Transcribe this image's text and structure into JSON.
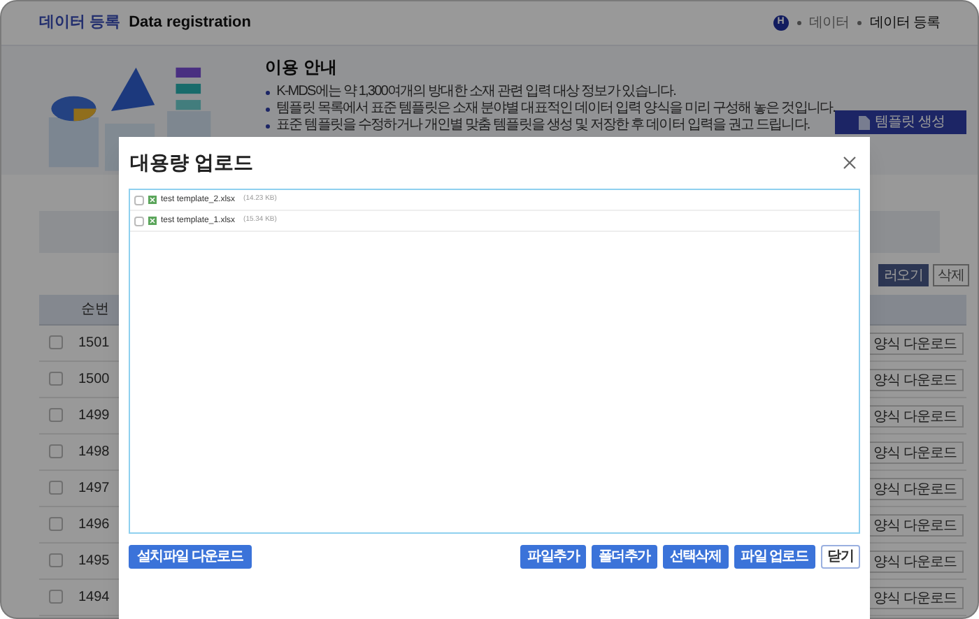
{
  "header": {
    "title_ko": "데이터 등록",
    "title_en": "Data registration",
    "home": "H",
    "breadcrumb": [
      "데이터",
      "데이터 등록"
    ]
  },
  "info": {
    "title": "이용 안내",
    "bullets": [
      "K-MDS에는 약 1,300여개의 방대한 소재 관련 입력 대상 정보가 있습니다.",
      "템플릿 목록에서 표준 템플릿은 소재 분야별 대표적인 데이터 입력 양식을 미리 구성해 놓은 것입니다.",
      "표준 템플릿을 수정하거나 개인별 맞춤 템플릿을 생성 및 저장한 후 데이터 입력을 권고 드립니다."
    ],
    "button": "템플릿 생성"
  },
  "toolbar": [
    {
      "label": "러오기",
      "kind": "primary"
    },
    {
      "label": "삭제",
      "kind": "outline"
    }
  ],
  "table": {
    "column": "순번",
    "rows": [
      {
        "no": "1501",
        "checked": false,
        "action": "양식 다운로드"
      },
      {
        "no": "1500",
        "checked": false,
        "action": "양식 다운로드"
      },
      {
        "no": "1499",
        "checked": false,
        "action": "양식 다운로드"
      },
      {
        "no": "1498",
        "checked": false,
        "action": "양식 다운로드"
      },
      {
        "no": "1497",
        "checked": false,
        "action": "양식 다운로드"
      },
      {
        "no": "1496",
        "checked": false,
        "action": "양식 다운로드"
      },
      {
        "no": "1495",
        "checked": false,
        "action": "양식 다운로드"
      },
      {
        "no": "1494",
        "checked": false,
        "action": "양식 다운로드"
      }
    ]
  },
  "modal": {
    "title": "대용량 업로드",
    "files": [
      {
        "name": "test template_2.xlsx",
        "size": "(14.23 KB)",
        "checked": false
      },
      {
        "name": "test template_1.xlsx",
        "size": "(15.34 KB)",
        "checked": false
      }
    ],
    "left_button": "설치파일 다운로드",
    "buttons": [
      {
        "label": "파일추가",
        "kind": "primary"
      },
      {
        "label": "폴더추가",
        "kind": "primary"
      },
      {
        "label": "선택삭제",
        "kind": "primary"
      },
      {
        "label": "파일 업로드",
        "kind": "primary"
      },
      {
        "label": "닫기",
        "kind": "outline"
      }
    ]
  }
}
